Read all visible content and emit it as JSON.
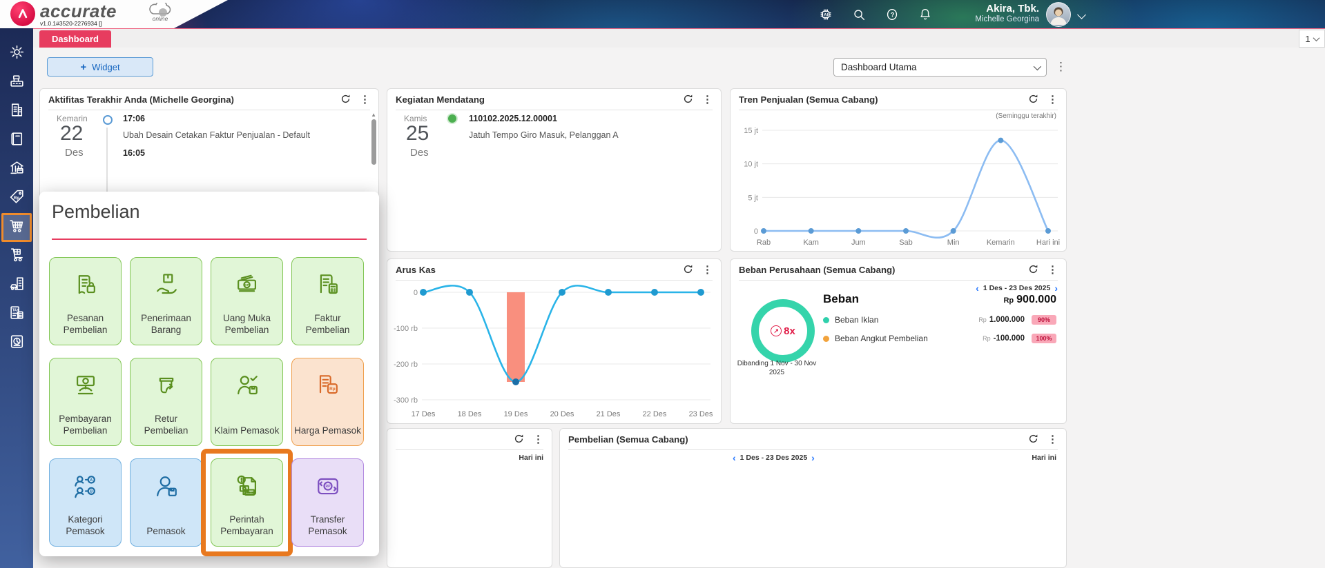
{
  "colors": {
    "accent_pink": "#e73c5f",
    "pink_line": "#ee6482",
    "highlight_orange": "#e8791f",
    "sidebar_active_orange": "#ef8b2c",
    "donut_teal": "#35d4ab",
    "ratio_red": "#e11d48",
    "blue_accent": "#2979ff",
    "badge_bg": "#f9a8b8",
    "badge_text": "#be123c"
  },
  "palette": {
    "green": {
      "bg": "#e1f6d7",
      "border": "#82c655",
      "icon": "#5a8f1f"
    },
    "orange": {
      "bg": "#fbe3cf",
      "border": "#efa04e",
      "icon": "#d96a2a"
    },
    "blue": {
      "bg": "#cfe6f8",
      "border": "#73b1e0",
      "icon": "#1d6ca3"
    },
    "purple": {
      "bg": "#e9def7",
      "border": "#b38ae0",
      "icon": "#7d4fc0"
    }
  },
  "header": {
    "logo_text": "accurate",
    "logo_online": "online",
    "version": "v1.0.1#3520-2276934 []",
    "company": "Akira, Tbk.",
    "user": "Michelle Georgina",
    "icons": [
      {
        "icon": "ai-icon"
      },
      {
        "icon": "search-icon"
      },
      {
        "icon": "help-icon"
      },
      {
        "icon": "bell-icon"
      }
    ]
  },
  "tabbar": {
    "dashboard": "Dashboard",
    "counter": "1"
  },
  "toolbar": {
    "widget_button": "Widget",
    "dashboard_select": "Dashboard Utama"
  },
  "sidebar": {
    "items": [
      {
        "icon": "gear-icon"
      },
      {
        "icon": "cash-register-icon"
      },
      {
        "icon": "company-icon"
      },
      {
        "icon": "book-icon"
      },
      {
        "icon": "bank-icon"
      },
      {
        "icon": "price-tag-icon"
      },
      {
        "icon": "cart-icon",
        "active": true
      },
      {
        "icon": "handtruck-icon"
      },
      {
        "icon": "asset-icon"
      },
      {
        "icon": "tax-icon"
      },
      {
        "icon": "pie-report-icon"
      }
    ]
  },
  "overlay": {
    "title": "Pembelian",
    "tiles": [
      {
        "label": "Pesanan Pembelian",
        "color": "green",
        "icon": "purchase-order-icon"
      },
      {
        "label": "Penerimaan Barang",
        "color": "green",
        "icon": "goods-receipt-icon"
      },
      {
        "label": "Uang Muka Pembelian",
        "color": "green",
        "icon": "down-payment-icon"
      },
      {
        "label": "Faktur Pembelian",
        "color": "green",
        "icon": "purchase-invoice-icon"
      },
      {
        "label": "Pembayaran Pembelian",
        "color": "green",
        "icon": "purchase-payment-icon"
      },
      {
        "label": "Retur Pembelian",
        "color": "green",
        "icon": "purchase-return-icon"
      },
      {
        "label": "Klaim Pemasok",
        "color": "green",
        "icon": "supplier-claim-icon"
      },
      {
        "label": "Harga Pemasok",
        "color": "orange",
        "icon": "supplier-price-icon"
      },
      {
        "label": "Kategori Pemasok",
        "color": "blue",
        "icon": "supplier-category-icon"
      },
      {
        "label": "Pemasok",
        "color": "blue",
        "icon": "supplier-icon"
      },
      {
        "label": "Perintah Pembayaran",
        "color": "green",
        "icon": "payment-order-icon",
        "highlighted": true
      },
      {
        "label": "Transfer Pemasok",
        "color": "purple",
        "icon": "supplier-transfer-icon"
      }
    ]
  },
  "widgets": {
    "aktifitas": {
      "title": "Aktifitas Terakhir Anda (Michelle Georgina)",
      "day_label": "Kemarin",
      "day_num": "22",
      "month": "Des",
      "entries": [
        {
          "time": "17:06",
          "text": "Ubah Desain Cetakan Faktur Penjualan - Default"
        },
        {
          "time": "16:05",
          "text": ""
        }
      ]
    },
    "kegiatan": {
      "title": "Kegiatan Mendatang",
      "day_label": "Kamis",
      "day_num": "25",
      "month": "Des",
      "doc_no": "110102.2025.12.00001",
      "desc": "Jatuh Tempo Giro Masuk, Pelanggan A"
    },
    "tren": {
      "title": "Tren Penjualan (Semua Cabang)",
      "subtitle": "(Seminggu terakhir)"
    },
    "arus": {
      "title": "Arus Kas"
    },
    "beban": {
      "title": "Beban Perusahaan (Semua Cabang)",
      "date_range": "1 Des - 23 Des 2025",
      "ratio": "8x",
      "compare": "Dibanding 1 Nov - 30 Nov 2025",
      "total_label": "Beban",
      "total_currency": "Rp",
      "total_amount": "900.000",
      "legend": [
        {
          "name": "Beban Iklan",
          "currency": "Rp",
          "amount": "1.000.000",
          "pct": "90%",
          "color": "#2fd0ac"
        },
        {
          "name": "Beban Angkut Pembelian",
          "currency": "Rp",
          "amount": "-100.000",
          "pct": "100%",
          "color": "#f2a33c"
        }
      ]
    },
    "bottom_left": {
      "hari_ini": "Hari ini"
    },
    "pembelian_cabang": {
      "title": "Pembelian (Semua Cabang)",
      "date_range": "1 Des - 23 Des 2025",
      "hari_ini": "Hari ini"
    }
  },
  "chart_data": [
    {
      "id": "tren_penjualan",
      "type": "line",
      "title": "Tren Penjualan (Semua Cabang)",
      "subtitle": "(Seminggu terakhir)",
      "categories": [
        "Rab",
        "Kam",
        "Jum",
        "Sab",
        "Min",
        "Kemarin",
        "Hari ini"
      ],
      "values": [
        0,
        0,
        0,
        0,
        0,
        13500000,
        0
      ],
      "unit": "Rp",
      "yticks": [
        {
          "label": "15 jt",
          "value": 15000000
        },
        {
          "label": "10 jt",
          "value": 10000000
        },
        {
          "label": "5 jt",
          "value": 5000000
        },
        {
          "label": "0",
          "value": 0
        }
      ],
      "ylim": [
        0,
        15000000
      ],
      "grid": true,
      "line_color": "#8cbcf2",
      "dot_color": "#5b9bd5"
    },
    {
      "id": "arus_kas",
      "type": "line+bar",
      "title": "Arus Kas",
      "categories": [
        "17 Des",
        "18 Des",
        "19 Des",
        "20 Des",
        "21 Des",
        "22 Des",
        "23 Des"
      ],
      "values": [
        0,
        0,
        -250000,
        0,
        0,
        0,
        0
      ],
      "bar_values": [
        null,
        null,
        -250000,
        null,
        null,
        null,
        null
      ],
      "unit": "Rp",
      "yticks": [
        {
          "label": "0",
          "value": 0
        },
        {
          "label": "-100 rb",
          "value": -100000
        },
        {
          "label": "-200 rb",
          "value": -200000
        },
        {
          "label": "-300 rb",
          "value": -300000
        }
      ],
      "ylim": [
        -300000,
        0
      ],
      "grid": true,
      "line_color": "#2ab4e8",
      "dot_color": "#1f9ad0",
      "dark_min_dot_color": "#1b6fa8",
      "bar_color": "#f98f7e"
    }
  ]
}
